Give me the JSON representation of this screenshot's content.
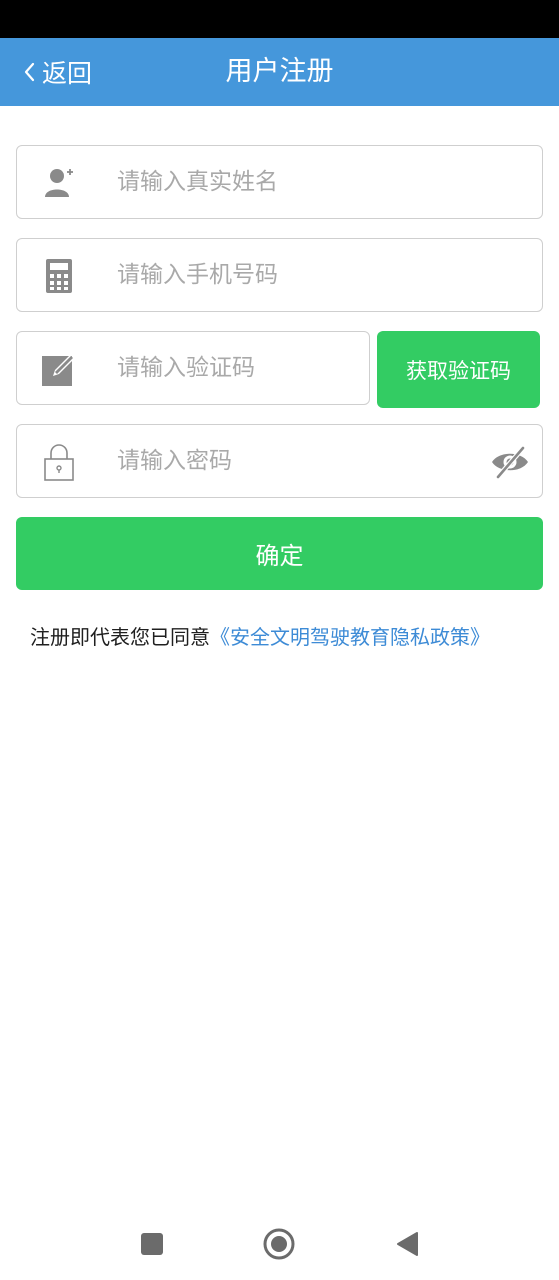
{
  "header": {
    "back_label": "返回",
    "title": "用户注册",
    "background": "#4597db"
  },
  "form": {
    "name_placeholder": "请输入真实姓名",
    "phone_placeholder": "请输入手机号码",
    "code_placeholder": "请输入验证码",
    "password_placeholder": "请输入密码",
    "get_code_label": "获取验证码",
    "confirm_label": "确定",
    "accent": "#33cc63"
  },
  "icons": {
    "name": "user-add-icon",
    "phone": "calculator-icon",
    "code": "edit-icon",
    "password": "lock-icon",
    "toggle": "eye-off-icon"
  },
  "agreement": {
    "text": "注册即代表您已同意",
    "link": "《安全文明驾驶教育隐私政策》",
    "link_color": "#3d8bd6"
  },
  "nav": {
    "recent": "square-icon",
    "home": "circle-icon",
    "back": "triangle-back-icon"
  }
}
